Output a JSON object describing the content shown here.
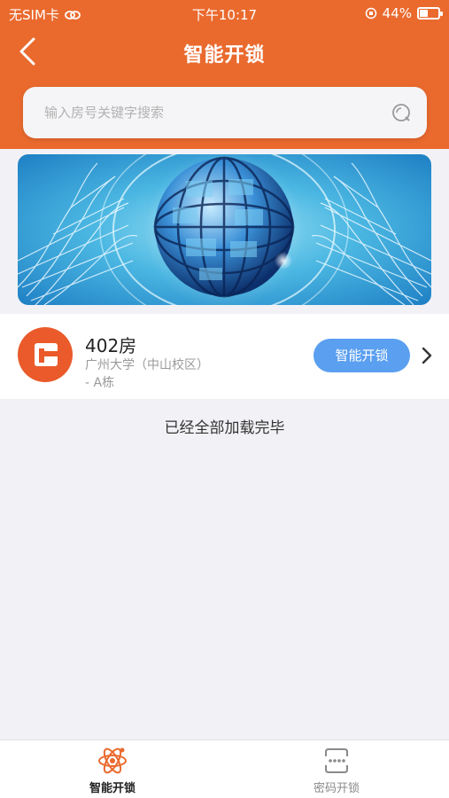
{
  "status_bar": {
    "carrier": "无SIM卡",
    "time": "下午10:17",
    "battery": "44%",
    "battery_level": 0.44
  },
  "nav": {
    "title": "智能开锁"
  },
  "search": {
    "placeholder": "输入房号关键字搜索"
  },
  "room": {
    "name": "402房",
    "location_line1": "广州大学（中山校区）",
    "location_line2": "- A栋",
    "action_label": "智能开锁"
  },
  "list_footer": "已经全部加载完毕",
  "tabbar": {
    "items": [
      {
        "label": "智能开锁",
        "icon": "atom-icon",
        "active": true
      },
      {
        "label": "密码开锁",
        "icon": "keypad-icon",
        "active": false
      }
    ]
  },
  "colors": {
    "header": "#ea6a2e",
    "accent_button": "#5a9ff0",
    "room_avatar": "#ea5a2a"
  }
}
